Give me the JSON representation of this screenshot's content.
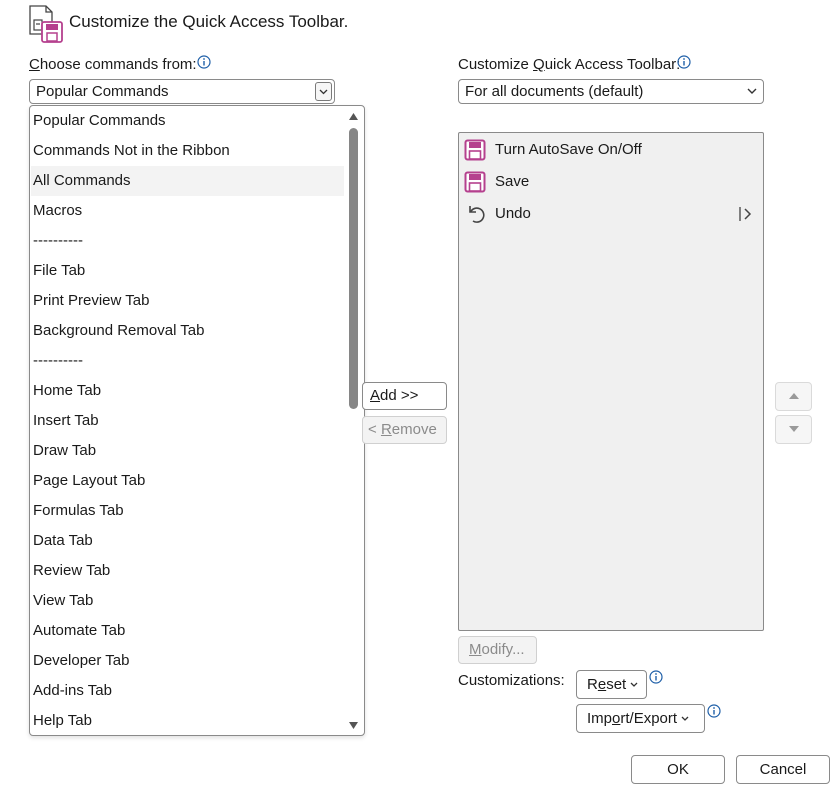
{
  "header": {
    "title": "Customize the Quick Access Toolbar."
  },
  "left": {
    "label_prefix": "C",
    "label_rest": "hoose commands from:",
    "combo_value": "Popular Commands",
    "options": [
      "Popular Commands",
      "Commands Not in the Ribbon",
      "All Commands",
      "Macros",
      "----------",
      "File Tab",
      "Print Preview Tab",
      "Background Removal Tab",
      "----------",
      "Home Tab",
      "Insert Tab",
      "Draw Tab",
      "Page Layout Tab",
      "Formulas Tab",
      "Data Tab",
      "Review Tab",
      "View Tab",
      "Automate Tab",
      "Developer Tab",
      "Add-ins Tab",
      "Help Tab"
    ],
    "highlighted_option_index": 2
  },
  "middle": {
    "add_key": "A",
    "add_rest": "dd >>",
    "remove_prefix": "< ",
    "remove_key": "R",
    "remove_rest": "emove"
  },
  "right": {
    "label_prefix": "Customize ",
    "label_key": "Q",
    "label_rest": "uick Access Toolbar:",
    "combo_value": "For all documents (default)",
    "items": [
      {
        "label": "Turn AutoSave On/Off",
        "icon": "save-icon"
      },
      {
        "label": "Save",
        "icon": "save-icon"
      },
      {
        "label": "Undo",
        "icon": "undo-icon"
      }
    ],
    "modify_key": "M",
    "modify_rest": "odify...",
    "customizations_label": "Customizations:",
    "reset_prefix": "R",
    "reset_key": "e",
    "reset_rest": "set",
    "import_prefix": "Imp",
    "import_key": "o",
    "import_rest": "rt/Export"
  },
  "footer": {
    "ok_label": "OK",
    "cancel_label": "Cancel"
  },
  "colors": {
    "accent": "#b5408e",
    "info": "#1f5fa8"
  }
}
